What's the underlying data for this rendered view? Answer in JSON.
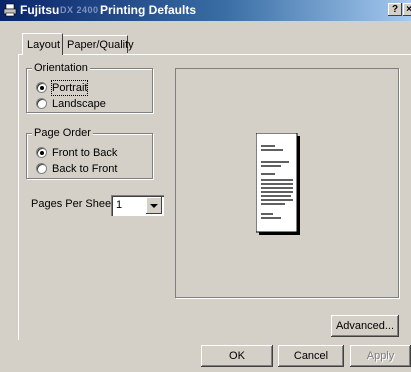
{
  "window": {
    "title_brand": "Fujitsu",
    "title_model": "DX 2400",
    "title_text": "Printing Defaults",
    "help_label": "?",
    "close_label": "×"
  },
  "tabs": [
    {
      "label": "Layout",
      "selected": true
    },
    {
      "label": "Paper/Quality",
      "selected": false
    }
  ],
  "orientation": {
    "legend": "Orientation",
    "options": [
      {
        "label": "Portrait",
        "checked": true
      },
      {
        "label": "Landscape",
        "checked": false
      }
    ]
  },
  "page_order": {
    "legend": "Page Order",
    "options": [
      {
        "label": "Front to Back",
        "checked": true
      },
      {
        "label": "Back to Front",
        "checked": false
      }
    ]
  },
  "pages_per_sheet": {
    "label": "Pages Per Sheet:",
    "value": "1"
  },
  "buttons": {
    "advanced": "Advanced...",
    "ok": "OK",
    "cancel": "Cancel",
    "apply": "Apply"
  }
}
